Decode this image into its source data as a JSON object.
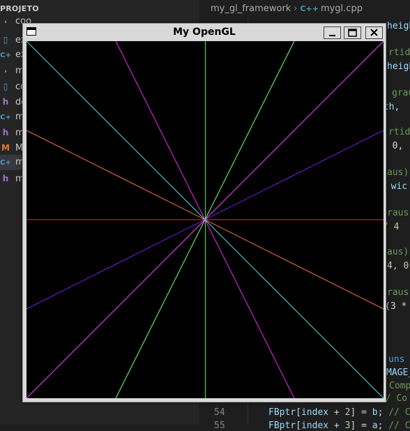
{
  "explorer": {
    "title": "PROJETO",
    "items": [
      {
        "label": "coo",
        "icon": "folder-chevron-icon"
      },
      {
        "label": "ex",
        "icon": "file-icon"
      },
      {
        "label": "ex",
        "icon": "cpp-file-icon"
      },
      {
        "label": "my",
        "icon": "folder-chevron-icon"
      },
      {
        "label": "co",
        "icon": "file-icon"
      },
      {
        "label": "de",
        "icon": "header-file-icon"
      },
      {
        "label": "m",
        "icon": "cpp-file-icon"
      },
      {
        "label": "m",
        "icon": "header-file-icon"
      },
      {
        "label": "M",
        "icon": "makefile-icon"
      },
      {
        "label": "m",
        "icon": "cpp-file-icon"
      },
      {
        "label": "m",
        "icon": "header-file-icon"
      }
    ]
  },
  "breadcrumb": {
    "folder": "my_gl_framework",
    "separator": "›",
    "cpp_icon": "C++",
    "file": "mygl.cpp"
  },
  "editor": {
    "line_numbers": [
      "54",
      "55"
    ],
    "fragments": [
      {
        "text": "heigh"
      },
      {
        "text": "rtido"
      },
      {
        "text": "heigh"
      },
      {
        "text": "grau"
      },
      {
        "text": "dth,"
      },
      {
        "text": "rtido"
      },
      {
        "text": ", 0,"
      },
      {
        "text": "aus)"
      },
      {
        "text": ", wic"
      },
      {
        "text": "raus)"
      },
      {
        "text": "/ 4"
      },
      {
        "text": "aus)"
      },
      {
        "text": "4, 0"
      },
      {
        "text": "raus"
      },
      {
        "text": "(3 *"
      },
      {
        "text": "uns"
      },
      {
        "text": "MAGE_"
      },
      {
        "text": "Comp"
      },
      {
        "text": "// Co"
      },
      {
        "text": "FBptr[index + 2] = b; // Co"
      },
      {
        "text": "FBptr[index + 3] = a; // C"
      }
    ]
  },
  "gl_window": {
    "title": "My OpenGL",
    "window_icon": "window-icon",
    "buttons": {
      "minimize": "minimize-icon",
      "maximize": "maximize-icon",
      "close": "close-icon"
    },
    "lines": [
      {
        "color": "#ff2020",
        "name": "horizontal red line"
      },
      {
        "color": "#20ff20",
        "name": "vertical green line"
      },
      {
        "color": "#ff20ff",
        "name": "magenta line"
      },
      {
        "color": "#7fff7f",
        "name": "light green line"
      },
      {
        "color": "#8020ff",
        "name": "violet line"
      },
      {
        "color": "#ff8040",
        "name": "orange line"
      },
      {
        "color": "#40e0e0",
        "name": "cyan line"
      },
      {
        "color": "#ff40ff",
        "name": "magenta line 2"
      }
    ]
  }
}
